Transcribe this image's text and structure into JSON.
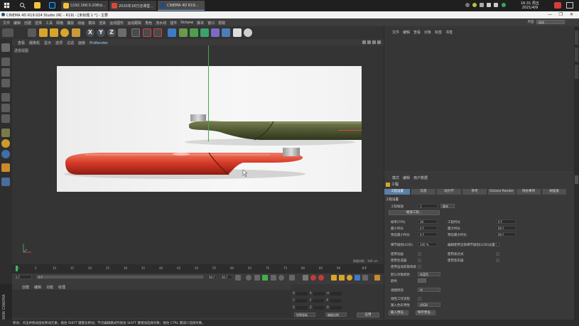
{
  "taskbar": {
    "tabs": [
      {
        "label": "\\\\192.168.0.208\\d..."
      },
      {
        "label": "2020年18万还课堂..."
      },
      {
        "label": "CINEMA 4D R19..."
      }
    ],
    "clock_time": "16:31 周五",
    "clock_date": "2021/4/9"
  },
  "window": {
    "title": "CINEMA 4D R19.024 Studio (RC - R19) - [未标题 1 *] - 主要"
  },
  "menu": [
    "文件",
    "编辑",
    "创建",
    "选择",
    "工具",
    "网格",
    "捕捉",
    "动画",
    "模拟",
    "渲染",
    "运动图形",
    "运动跟踪",
    "角色",
    "流水线",
    "插件",
    "Octane",
    "脚本",
    "窗口",
    "帮助"
  ],
  "layout": {
    "label": "界面:",
    "value": "启动"
  },
  "toolbar": {
    "x": "X",
    "y": "Y",
    "z": "Z"
  },
  "viewport": {
    "menu": [
      "查看",
      "摄像机",
      "显示",
      "选项",
      "过滤",
      "面板",
      "ProRender"
    ],
    "label": "透视视图",
    "grid_label": "网格间距 : 100 cm"
  },
  "timeline": {
    "ticks": [
      "0",
      "5",
      "10",
      "15",
      "20",
      "25",
      "30",
      "35",
      "40",
      "45",
      "50",
      "55",
      "60",
      "65",
      "70",
      "75",
      "80",
      "85",
      "90"
    ],
    "start": "0 F",
    "current": "0 F",
    "end": "90 F",
    "end2": "90 F",
    "frame_right": "0 F"
  },
  "material": {
    "menu": [
      "创建",
      "编辑",
      "功能",
      "纹理"
    ]
  },
  "coords": {
    "rows": [
      {
        "a": "X",
        "b": "X",
        "c": "H"
      },
      {
        "a": "Y",
        "b": "Y",
        "c": "P"
      },
      {
        "a": "Z",
        "b": "Z",
        "c": "B"
      }
    ],
    "values": [
      "0 cm",
      "0 cm",
      "0 °"
    ],
    "drop1": "世界坐标",
    "drop2": "缩放比例",
    "apply": "应用"
  },
  "status": {
    "text": "移动：点击并拖动鼠标移动元素。按住 SHIFT 键量化移动；节点编辑模式时按住 SHIFT 键增加选择对象；按住 CTRL 键减少选择对象。"
  },
  "object_panel": {
    "menu": [
      "文件",
      "编辑",
      "查看",
      "对象",
      "标签",
      "书签"
    ]
  },
  "attr_panel": {
    "menu": [
      "模式",
      "编辑",
      "用户数据"
    ],
    "title": "工程",
    "tabs": [
      "工程设置",
      "信息",
      "动力学",
      "参考",
      "Octane Render",
      "待办事项",
      "帧插值"
    ],
    "section": "工程设置",
    "scale_label": "工程缩放",
    "scale_value": "1",
    "scale_unit": "厘米",
    "scale_btn": "缩放工程...",
    "fps_label": "帧率(FPS)",
    "fps_value": "30",
    "time_label": "工程时长",
    "time_value": "0 F",
    "min_time_label": "最小时长",
    "min_time_value": "0 F",
    "max_time_label": "最大时长",
    "max_time_value": "90 F",
    "prev_min_label": "预览最小时长",
    "prev_min_value": "0 F",
    "prev_max_label": "预览最大时长",
    "prev_max_value": "90 F",
    "lod_label": "细节级别(LOD)",
    "lod_value": "100 %",
    "lod_render_label": "编辑使用渲染细节级别(LOD)设置",
    "use_anim": "使用动画",
    "use_expr": "使用表达式",
    "use_gen": "使用生成器",
    "use_deform": "使用变形器",
    "use_motion": "使用运动剪辑系统",
    "default_color_label": "默认对象颜色",
    "default_color_value": "灰蓝色",
    "color_label": "颜色",
    "view_clip_label": "视图修剪",
    "view_clip_value": "中",
    "linear_label": "线性工作流程",
    "input_color_label": "输入色彩特性",
    "input_color_value": "sRGB",
    "load_preset": "载入预设...",
    "save_preset": "保存预设..."
  },
  "brand": "MAXON CINEMA 4D"
}
